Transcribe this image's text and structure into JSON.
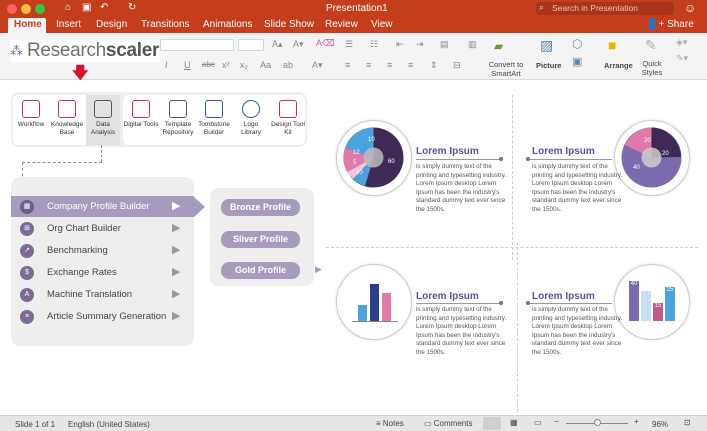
{
  "app": {
    "title": "Presentation1",
    "search_placeholder": "Search in Presentation",
    "share": "Share"
  },
  "tabs": [
    "Home",
    "Insert",
    "Design",
    "Transitions",
    "Animations",
    "Slide Show",
    "Review",
    "View"
  ],
  "ribbon": {
    "convert_label": "Convert to SmartArt",
    "picture": "Picture",
    "arrange": "Arrange",
    "quick_styles": "Quick Styles"
  },
  "logo": {
    "text_a": "Research",
    "text_b": "scaler"
  },
  "tools": [
    "Workflow",
    "Knowledge Base",
    "Data Analysis",
    "Digital Tools",
    "Template Repository",
    "Tombstone Builder",
    "Logo Library",
    "Design Tool Kit"
  ],
  "menu": [
    "Company Profile Builder",
    "Org Chart Builder",
    "Benchmarking",
    "Exchange Rates",
    "Machine Translation",
    "Article Summary Generation"
  ],
  "profiles": [
    "Bronze Profile",
    "Sliver Profile",
    "Gold Profile"
  ],
  "cards": {
    "title": "Lorem Ipsum",
    "text": "is simply dummy text of the printing and typesetting industry. Lorem Ipsum desktop Lorem Ipsum has been the industry's standard dummy text ever since the 1500s.",
    "pie1": [
      "10",
      "12",
      "5",
      "10",
      "60"
    ],
    "pie2": [
      "20",
      "20",
      "40"
    ],
    "bars": [
      "40",
      "15",
      "25"
    ]
  },
  "status": {
    "slide": "Slide 1 of 1",
    "lang": "English (United States)",
    "notes": "Notes",
    "comments": "Comments",
    "zoom": "96%"
  },
  "colors": {
    "brand": "#c43e1c",
    "accent": "#7b6a95"
  }
}
